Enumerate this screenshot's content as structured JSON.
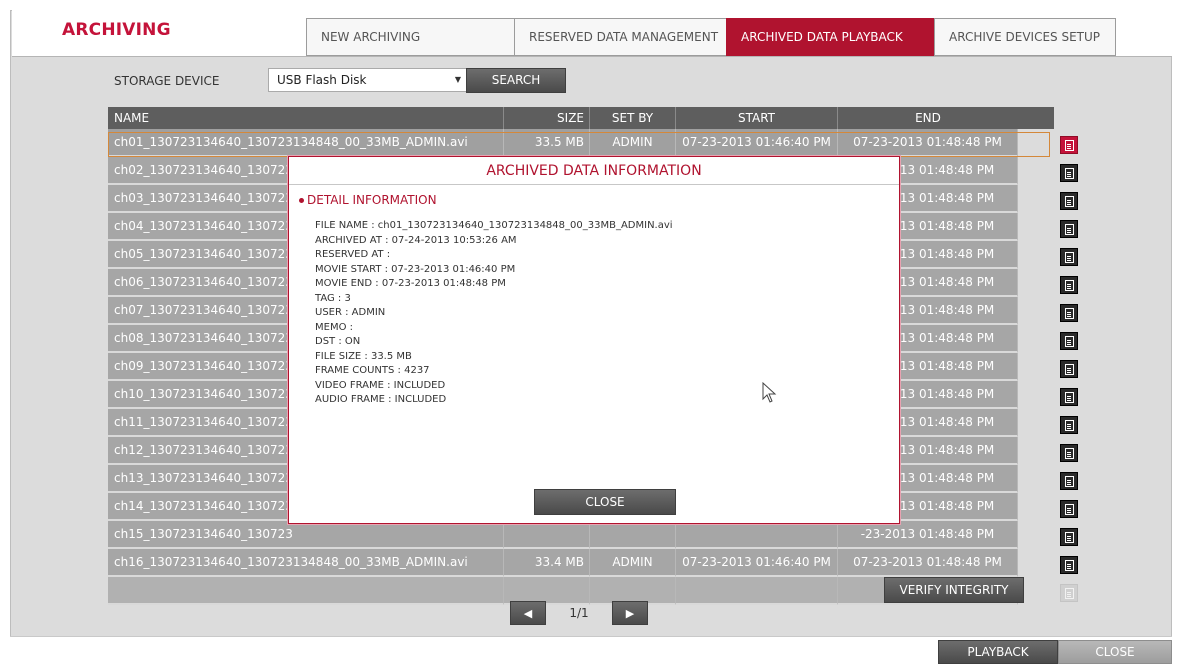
{
  "page": {
    "title": "ARCHIVING"
  },
  "tabs": [
    {
      "label": "NEW ARCHIVING",
      "active": false
    },
    {
      "label": "RESERVED DATA MANAGEMENT",
      "active": false
    },
    {
      "label": "ARCHIVED DATA PLAYBACK",
      "active": true
    },
    {
      "label": "ARCHIVE DEVICES SETUP",
      "active": false
    }
  ],
  "storage": {
    "label": "STORAGE DEVICE",
    "selected": "USB Flash Disk",
    "search_label": "SEARCH"
  },
  "table": {
    "headers": {
      "name": "NAME",
      "size": "SIZE",
      "set_by": "SET BY",
      "start": "START",
      "end": "END"
    },
    "rows": [
      {
        "name": "ch01_130723134640_130723134848_00_33MB_ADMIN.avi",
        "size": "33.5 MB",
        "set_by": "ADMIN",
        "start": "07-23-2013 01:46:40 PM",
        "end": "07-23-2013 01:48:48 PM"
      },
      {
        "name": "ch02_130723134640_130723",
        "size": "",
        "set_by": "",
        "start": "",
        "end": "-23-2013 01:48:48 PM"
      },
      {
        "name": "ch03_130723134640_130723",
        "size": "",
        "set_by": "",
        "start": "",
        "end": "-23-2013 01:48:48 PM"
      },
      {
        "name": "ch04_130723134640_130723",
        "size": "",
        "set_by": "",
        "start": "",
        "end": "-23-2013 01:48:48 PM"
      },
      {
        "name": "ch05_130723134640_130723",
        "size": "",
        "set_by": "",
        "start": "",
        "end": "-23-2013 01:48:48 PM"
      },
      {
        "name": "ch06_130723134640_130723",
        "size": "",
        "set_by": "",
        "start": "",
        "end": "-23-2013 01:48:48 PM"
      },
      {
        "name": "ch07_130723134640_130723",
        "size": "",
        "set_by": "",
        "start": "",
        "end": "-23-2013 01:48:48 PM"
      },
      {
        "name": "ch08_130723134640_130723",
        "size": "",
        "set_by": "",
        "start": "",
        "end": "-23-2013 01:48:48 PM"
      },
      {
        "name": "ch09_130723134640_130723",
        "size": "",
        "set_by": "",
        "start": "",
        "end": "-23-2013 01:48:48 PM"
      },
      {
        "name": "ch10_130723134640_130723",
        "size": "",
        "set_by": "",
        "start": "",
        "end": "-23-2013 01:48:48 PM"
      },
      {
        "name": "ch11_130723134640_130723",
        "size": "",
        "set_by": "",
        "start": "",
        "end": "-23-2013 01:48:48 PM"
      },
      {
        "name": "ch12_130723134640_130723",
        "size": "",
        "set_by": "",
        "start": "",
        "end": "-23-2013 01:48:48 PM"
      },
      {
        "name": "ch13_130723134640_130723",
        "size": "",
        "set_by": "",
        "start": "",
        "end": "-23-2013 01:48:48 PM"
      },
      {
        "name": "ch14_130723134640_130723",
        "size": "",
        "set_by": "",
        "start": "",
        "end": "-23-2013 01:48:48 PM"
      },
      {
        "name": "ch15_130723134640_130723",
        "size": "",
        "set_by": "",
        "start": "",
        "end": "-23-2013 01:48:48 PM"
      },
      {
        "name": "ch16_130723134640_130723134848_00_33MB_ADMIN.avi",
        "size": "33.4 MB",
        "set_by": "ADMIN",
        "start": "07-23-2013 01:46:40 PM",
        "end": "07-23-2013 01:48:48 PM"
      }
    ]
  },
  "pager": {
    "text": "1/1",
    "prev_icon": "triangle-left-icon",
    "next_icon": "triangle-right-icon"
  },
  "verify_label": "VERIFY INTEGRITY",
  "footer": {
    "playback_label": "PLAYBACK",
    "close_label": "CLOSE"
  },
  "modal": {
    "title": "ARCHIVED DATA INFORMATION",
    "section": "DETAIL INFORMATION",
    "lines": [
      "FILE NAME : ch01_130723134640_130723134848_00_33MB_ADMIN.avi",
      "ARCHIVED AT : 07-24-2013  10:53:26 AM",
      "RESERVED AT :",
      "MOVIE START : 07-23-2013  01:46:40 PM",
      "MOVIE END : 07-23-2013  01:48:48 PM",
      "TAG : 3",
      "USER : ADMIN",
      "MEMO :",
      "DST : ON",
      "FILE SIZE : 33.5 MB",
      "FRAME COUNTS : 4237",
      "VIDEO FRAME : INCLUDED",
      "AUDIO FRAME : INCLUDED"
    ],
    "close_label": "CLOSE"
  },
  "colors": {
    "accent": "#b0132f",
    "title_red": "#c4133a",
    "row_gray": "#a6a6a6",
    "header_dark": "#5e5e5e"
  }
}
